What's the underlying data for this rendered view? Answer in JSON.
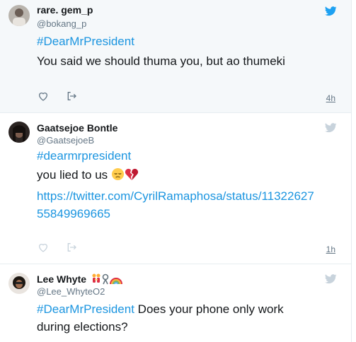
{
  "tweets": [
    {
      "name": "rare. gem_p",
      "handle": "@bokang_p",
      "hashtag": "#DearMrPresident",
      "body": "You said we should thuma you, but ao thumeki",
      "time": "4h"
    },
    {
      "name": "Gaatsejoe Bontle",
      "handle": "@GaatsejoeB",
      "hashtag": "#dearmrpresident",
      "body": "you lied to us",
      "emojis": [
        "pensive-face",
        "broken-heart"
      ],
      "link_line1": "https://twitter.com/CyrilRamaphosa/status/11322627",
      "link_line2": "55849969665",
      "time": "1h"
    },
    {
      "name": "Lee Whyte",
      "name_emojis": [
        "women-holding-hands",
        "ribbon-symbol",
        "rainbow"
      ],
      "handle": "@Lee_WhyteO2",
      "hashtag": "#DearMrPresident",
      "body": " Does your phone only work",
      "body2": "during elections?"
    }
  ],
  "colors": {
    "accent": "#1b95e0",
    "bird_active": "#1da1f2",
    "bird_muted": "#c8d3dc",
    "muted_text": "#657786"
  }
}
